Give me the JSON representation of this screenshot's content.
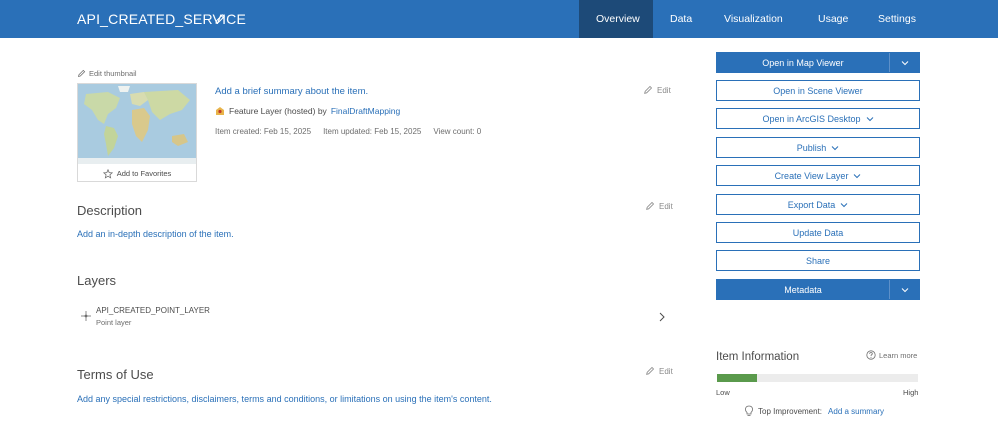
{
  "header": {
    "title": "API_CREATED_SERVICE",
    "tabs": [
      "Overview",
      "Data",
      "Visualization",
      "Usage",
      "Settings"
    ],
    "active_tab": "Overview"
  },
  "thumbnail": {
    "edit_label": "Edit thumbnail",
    "favorite_label": "Add to Favorites"
  },
  "summary": {
    "text": "Add a brief summary about the item.",
    "edit_label": "Edit",
    "layer_type": "Feature Layer (hosted) by",
    "owner": "FinalDraftMapping",
    "item_created": "Item created: Feb 15, 2025",
    "item_updated": "Item updated: Feb 15, 2025",
    "view_count": "View count: 0"
  },
  "description": {
    "heading": "Description",
    "edit_label": "Edit",
    "link": "Add an in-depth description of the item."
  },
  "layers": {
    "heading": "Layers",
    "items": [
      {
        "name": "API_CREATED_POINT_LAYER",
        "kind": "Point layer"
      }
    ]
  },
  "terms": {
    "heading": "Terms of Use",
    "edit_label": "Edit",
    "link": "Add any special restrictions, disclaimers, terms and conditions, or limitations on using the item's content."
  },
  "actions": {
    "open_map_viewer": "Open in Map Viewer",
    "open_scene_viewer": "Open in Scene Viewer",
    "open_arcgis_desktop": "Open in ArcGIS Desktop",
    "publish": "Publish",
    "create_view_layer": "Create View Layer",
    "export_data": "Export Data",
    "update_data": "Update Data",
    "share": "Share",
    "metadata": "Metadata"
  },
  "item_info": {
    "title": "Item Information",
    "learn_more": "Learn more",
    "low": "Low",
    "high": "High",
    "progress_fraction": 0.2,
    "top_improvement_label": "Top Improvement:",
    "top_improvement_link": "Add a summary"
  },
  "colors": {
    "brand_blue": "#2a70b8",
    "active_tab": "#1d4a78",
    "progress_green": "#5a9a4c"
  }
}
